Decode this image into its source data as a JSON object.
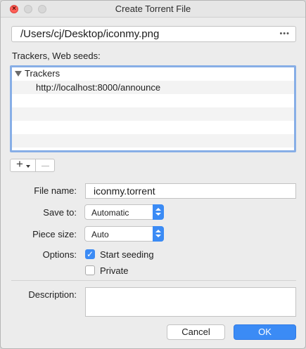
{
  "window": {
    "title": "Create Torrent File"
  },
  "path": {
    "value": "/Users/cj/Desktop/iconmy.png",
    "browse_icon": "ellipsis-icon",
    "browse_glyph": "•••"
  },
  "trackers": {
    "section_label": "Trackers, Web seeds:",
    "group_label": "Trackers",
    "items": [
      "http://localhost:8000/announce"
    ]
  },
  "list_controls": {
    "add_glyph": "+",
    "remove_glyph": "—"
  },
  "form": {
    "file_name": {
      "label": "File name:",
      "value": "iconmy.torrent"
    },
    "save_to": {
      "label": "Save to:",
      "value": "Automatic"
    },
    "piece_size": {
      "label": "Piece size:",
      "value": "Auto"
    },
    "options": {
      "label": "Options:",
      "start_seeding": {
        "label": "Start seeding",
        "checked": true
      },
      "private": {
        "label": "Private",
        "checked": false
      }
    },
    "description": {
      "label": "Description:",
      "value": ""
    }
  },
  "buttons": {
    "cancel": "Cancel",
    "ok": "OK"
  },
  "colors": {
    "accent": "#3b8bf5",
    "close_button": "#fe5f57",
    "focus_ring": "#87aee6"
  }
}
